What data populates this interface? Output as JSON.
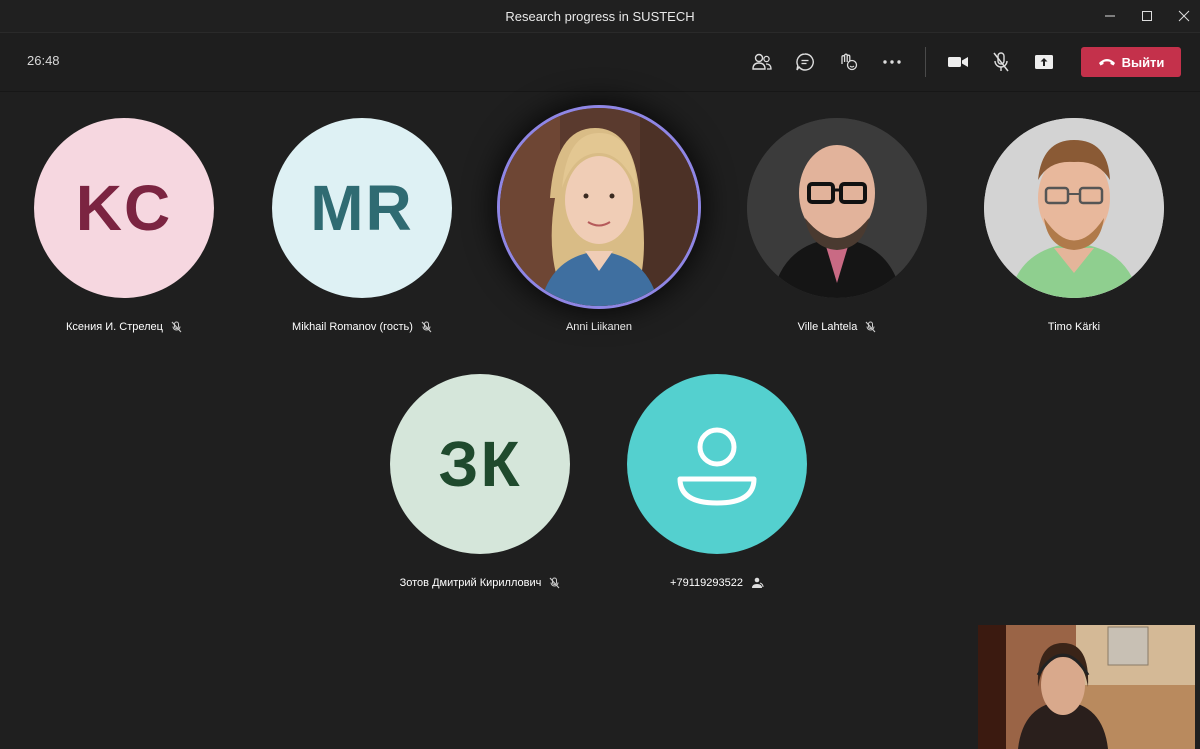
{
  "window": {
    "title": "Research progress in SUSTECH"
  },
  "toolbar": {
    "timer": "26:48",
    "icons": [
      "participants-icon",
      "chat-icon",
      "reactions-icon",
      "more-icon",
      "camera-icon",
      "mic-off-icon",
      "share-icon"
    ],
    "leave_label": "Выйти",
    "leave_color": "#c4314b"
  },
  "participants": [
    {
      "name": "Ксения И. Стрелец",
      "initials": "KC",
      "bg": "#f6d7e0",
      "fg": "#7b2441",
      "muted": true
    },
    {
      "name": "Mikhail Romanov (гость)",
      "initials": "MR",
      "bg": "#def1f4",
      "fg": "#2f6b72",
      "muted": true
    },
    {
      "name": "Anni Liikanen",
      "photo": true,
      "speaking": true,
      "muted": false
    },
    {
      "name": "Ville Lahtela",
      "photo": true,
      "muted": true
    },
    {
      "name": "Timo Kärki",
      "photo": true,
      "muted": false
    },
    {
      "name": "Зотов Дмитрий Кириллович",
      "initials": "ЗК",
      "bg": "#d5e6da",
      "fg": "#1f4a2d",
      "muted": true
    },
    {
      "name": "+79119293522",
      "icon": "person-icon",
      "bg": "#54d0cf",
      "phone": true
    }
  ]
}
